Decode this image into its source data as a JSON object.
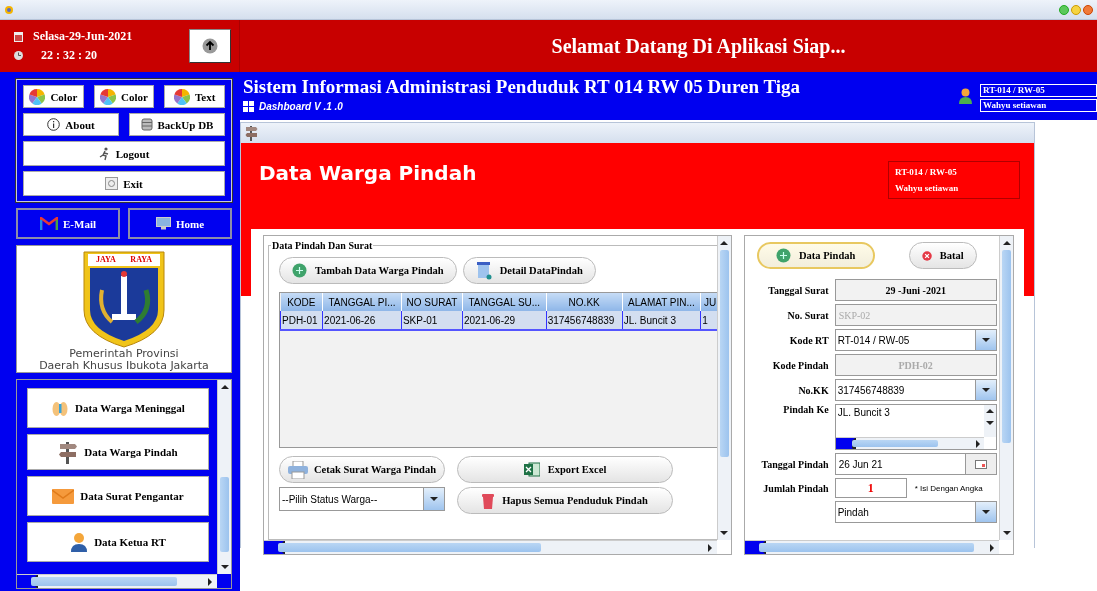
{
  "clock": {
    "date": "Selasa-29-Jun-2021",
    "time": "22 : 32 : 20"
  },
  "header": {
    "welcome": "Selamat Datang Di Aplikasi Siap..."
  },
  "tools": [
    {
      "label": "Color",
      "kind": "color"
    },
    {
      "label": "Color",
      "kind": "color"
    },
    {
      "label": "Text",
      "kind": "color"
    },
    {
      "label": "About",
      "kind": "about"
    },
    {
      "label": "BackUp DB",
      "kind": "backup"
    },
    {
      "label": "Logout",
      "kind": "logout"
    },
    {
      "label": "Exit",
      "kind": "exit"
    }
  ],
  "links": [
    {
      "label": "E-Mail",
      "kind": "mail"
    },
    {
      "label": "Home",
      "kind": "home"
    }
  ],
  "logo": {
    "motto_left": "JAYA",
    "motto_right": "RAYA",
    "caption": "Pemerintah Provinsi\nDaerah Khusus Ibukota Jakarta"
  },
  "menu": [
    {
      "label": "Data Warga Meninggal",
      "kind": "deceased"
    },
    {
      "label": "Data Warga Pindah",
      "kind": "signpost"
    },
    {
      "label": "Data Surat Pengantar",
      "kind": "envelope"
    },
    {
      "label": "Data Ketua RT",
      "kind": "person"
    }
  ],
  "banner": {
    "title": "Sistem Informasi Administrasi Penduduk RT 014 RW 05 Duren Tiga",
    "subtitle": "Dashboard V .1 .0",
    "rt": "RT-014 / RW-05",
    "user": "Wahyu setiawan"
  },
  "page": {
    "title": "Data Warga Pindah",
    "rt": "RT-014 / RW-05",
    "user": "Wahyu setiawan"
  },
  "list_panel": {
    "legend": "Data Pindah Dan Surat",
    "top_buttons": [
      {
        "label": "Tambah Data Warga Pindah",
        "kind": "add"
      },
      {
        "label": "Detail DataPindah",
        "kind": "detail"
      }
    ],
    "table": {
      "columns": [
        "KODE",
        "TANGGAL PI...",
        "NO SURAT",
        "TANGGAL SU...",
        "NO.KK",
        "ALAMAT PIN...",
        "JU"
      ],
      "rows": [
        {
          "cells": [
            "PDH-01",
            "2021-06-26",
            "SKP-01",
            "2021-06-29",
            "317456748839",
            "JL. Buncit 3",
            "1"
          ],
          "selected": true
        }
      ]
    },
    "print_button": {
      "label": "Cetak Surat Warga Pindah"
    },
    "export_button": {
      "label": "Export Excel"
    },
    "status_select": {
      "value": "--Pilih Status Warga--"
    },
    "delete_button": {
      "label": "Hapus Semua Penduduk Pindah"
    }
  },
  "form": {
    "buttons": [
      {
        "label": "Data Pindah",
        "kind": "add",
        "focused": true
      },
      {
        "label": "Batal",
        "kind": "cancel",
        "focused": false
      }
    ],
    "fields": [
      {
        "label": "Tanggal Surat",
        "kind": "display",
        "value": "29 -Juni -2021",
        "disabled": false
      },
      {
        "label": "No. Surat",
        "kind": "text",
        "value": "SKP-02",
        "disabled": true
      },
      {
        "label": "Kode RT",
        "kind": "combo",
        "value": "RT-014 / RW-05",
        "disabled": false
      },
      {
        "label": "Kode Pindah",
        "kind": "display",
        "value": "PDH-02",
        "disabled": true
      },
      {
        "label": "No.KK",
        "kind": "combo",
        "value": "317456748839",
        "disabled": false
      },
      {
        "label": "Pindah Ke",
        "kind": "textarea",
        "value": "JL. Buncit 3",
        "disabled": false
      },
      {
        "label": "Tanggal Pindah",
        "kind": "date",
        "value": "26 Jun 21",
        "disabled": false
      },
      {
        "label": "Jumlah Pindah",
        "kind": "number",
        "value": "1",
        "hint": "* Isi Dengan Angka",
        "disabled": false
      },
      {
        "kind": "combo",
        "value": "Pindah",
        "disabled": false
      }
    ]
  }
}
